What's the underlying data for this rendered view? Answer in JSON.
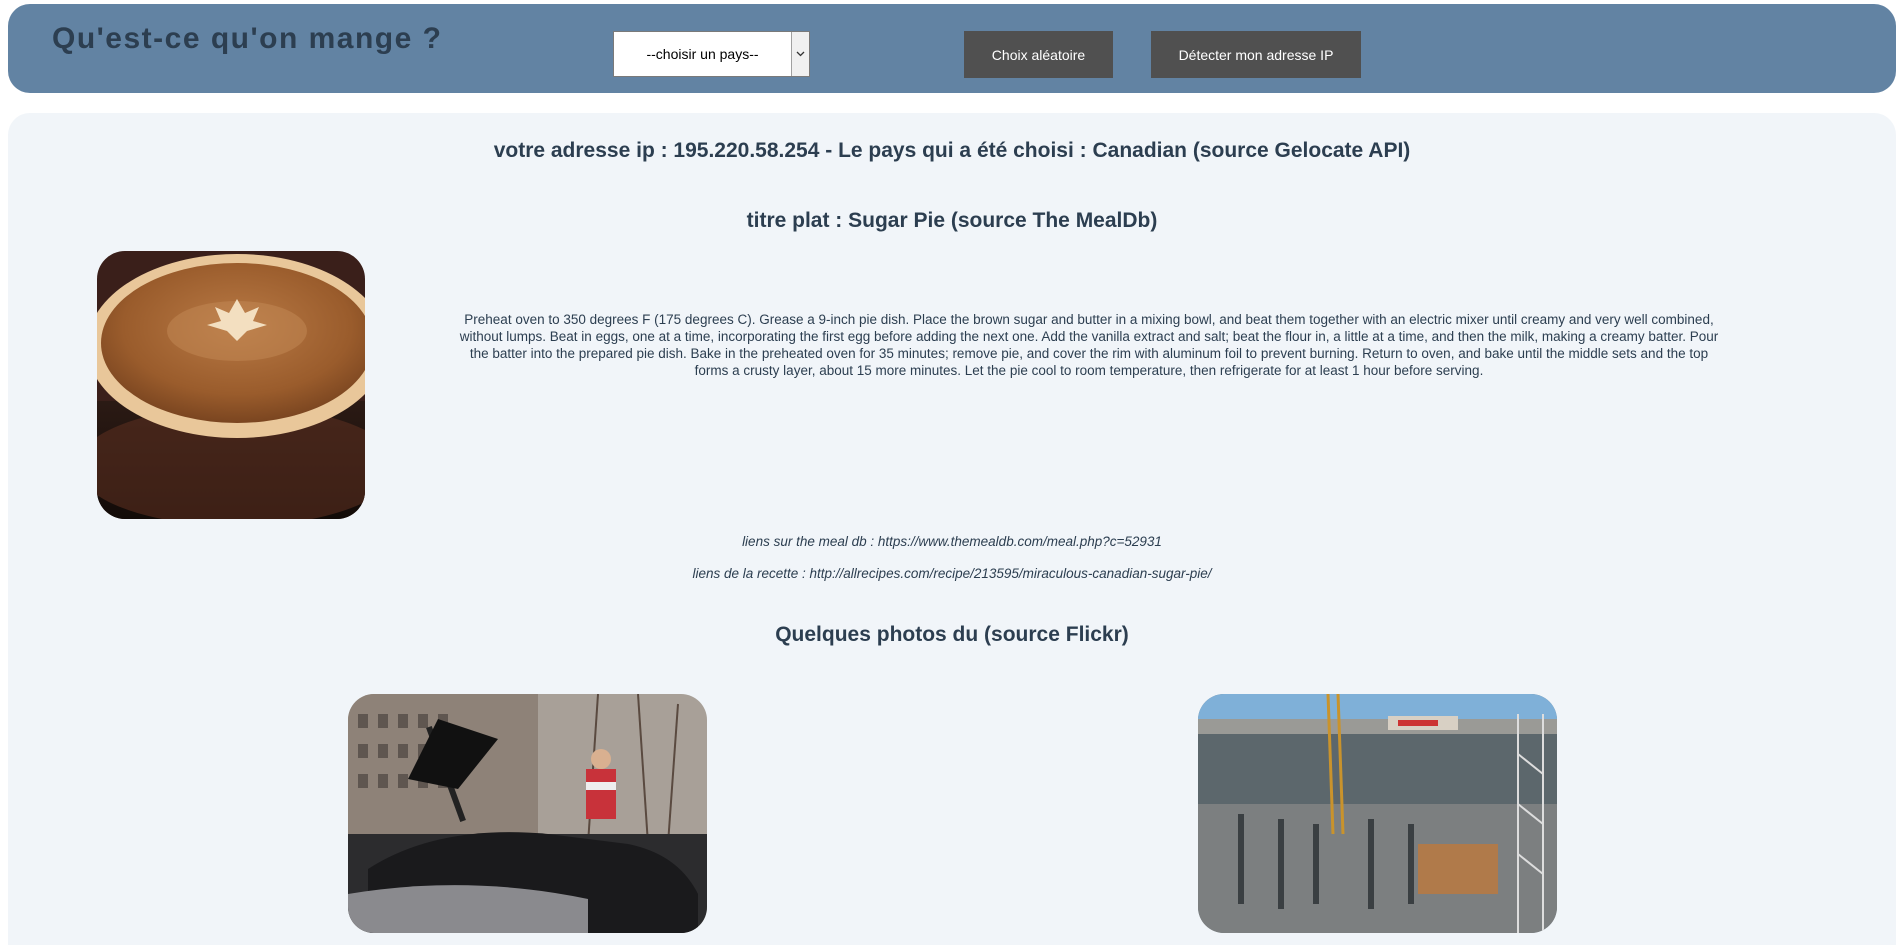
{
  "header": {
    "title": "Qu'est-ce qu'on mange ?",
    "country_select": {
      "selected": "--choisir un pays--"
    },
    "random_button_label": "Choix aléatoire",
    "detect_ip_button_label": "Détecter mon adresse IP"
  },
  "main": {
    "ip_line": "votre adresse ip : 195.220.58.254 - Le pays qui a été choisi : Canadian (source Gelocate API)",
    "dish_title": "titre plat : Sugar Pie (source The MealDb)",
    "instructions": "Preheat oven to 350 degrees F (175 degrees C). Grease a 9-inch pie dish. Place the brown sugar and butter in a mixing bowl, and beat them together with an electric mixer until creamy and very well combined, without lumps. Beat in eggs, one at a time, incorporating the first egg before adding the next one. Add the vanilla extract and salt; beat the flour in, a little at a time, and then the milk, making a creamy batter. Pour the batter into the prepared pie dish. Bake in the preheated oven for 35 minutes; remove pie, and cover the rim with aluminum foil to prevent burning. Return to oven, and bake until the middle sets and the top forms a crusty layer, about 15 more minutes. Let the pie cool to room temperature, then refrigerate for at least 1 hour before serving.",
    "mealdb_link": "liens sur the meal db : https://www.themealdb.com/meal.php?c=52931",
    "recipe_link": "liens de la recette : http://allrecipes.com/recipe/213595/miraculous-canadian-sugar-pie/",
    "photos_title": "Quelques photos du (source Flickr)"
  },
  "icons": {
    "select_arrow": "chevron-down-icon"
  },
  "colors": {
    "header_bg": "#6283a3",
    "title_text": "#2c3e50",
    "button_bg": "#505050",
    "panel_bg": "#f1f5f9"
  }
}
